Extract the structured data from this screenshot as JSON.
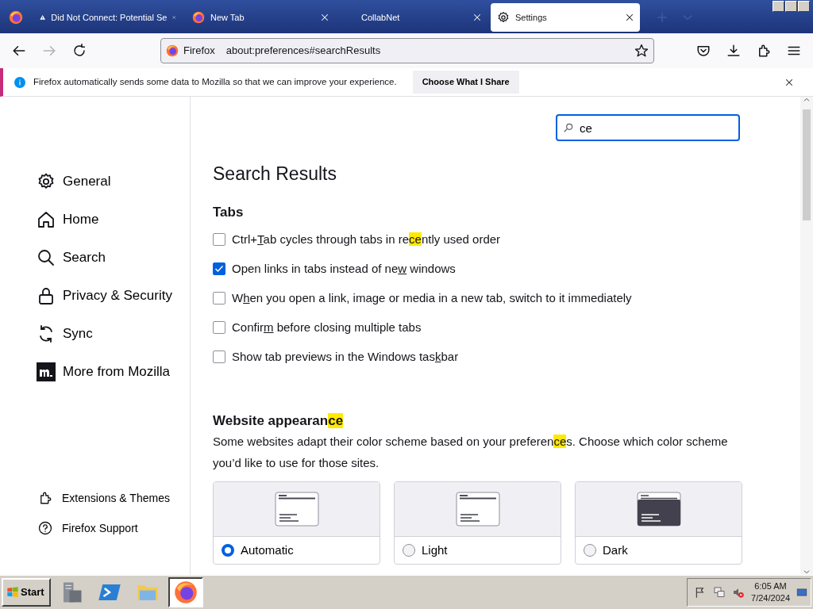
{
  "browser": {
    "tabs": [
      {
        "kind": "view",
        "selected": false
      },
      {
        "kind": "warning",
        "label": "Did Not Connect: Potential Se",
        "selected": false
      },
      {
        "kind": "firefox",
        "label": "New Tab",
        "selected": false
      },
      {
        "kind": "plain",
        "label": "CollabNet",
        "selected": false
      },
      {
        "kind": "gear",
        "label": "Settings",
        "selected": true
      }
    ],
    "url": {
      "identity": "Firefox",
      "address": "about:preferences#searchResults"
    },
    "notification": {
      "message": "Firefox automatically sends some data to Mozilla so that we can improve your experience.",
      "button": "Choose What I Share"
    }
  },
  "sidebar": {
    "categories": [
      {
        "label": "General",
        "selected": false
      },
      {
        "label": "Home",
        "selected": false
      },
      {
        "label": "Search",
        "selected": false
      },
      {
        "label": "Privacy & Security",
        "selected": false
      },
      {
        "label": "Sync",
        "selected": false
      },
      {
        "label": "More from Mozilla",
        "selected": false
      }
    ],
    "footer": [
      {
        "label": "Extensions & Themes"
      },
      {
        "label": "Firefox Support"
      }
    ]
  },
  "search": {
    "value": "ce"
  },
  "results": {
    "title": "Search Results",
    "sections": [
      {
        "kind": "checkboxes",
        "heading": [
          {
            "kind": "plain",
            "text": "Tabs"
          }
        ],
        "options": [
          {
            "checked": false,
            "label": [
              {
                "kind": "plain",
                "text": "Ctrl+"
              },
              {
                "kind": "access",
                "text": "T"
              },
              {
                "kind": "plain",
                "text": "ab cycles through tabs in re"
              },
              {
                "kind": "match",
                "text": "ce"
              },
              {
                "kind": "plain",
                "text": "ntly used order"
              }
            ]
          },
          {
            "checked": true,
            "label": [
              {
                "kind": "plain",
                "text": "Open links in tabs instead of ne"
              },
              {
                "kind": "access",
                "text": "w"
              },
              {
                "kind": "plain",
                "text": " windows"
              }
            ]
          },
          {
            "checked": false,
            "label": [
              {
                "kind": "plain",
                "text": "W"
              },
              {
                "kind": "access",
                "text": "h"
              },
              {
                "kind": "plain",
                "text": "en you open a link, image or media in a new tab, switch to it immediately"
              }
            ]
          },
          {
            "checked": false,
            "label": [
              {
                "kind": "plain",
                "text": "Confir"
              },
              {
                "kind": "access",
                "text": "m"
              },
              {
                "kind": "plain",
                "text": " before closing multiple tabs"
              }
            ]
          },
          {
            "checked": false,
            "label": [
              {
                "kind": "plain",
                "text": "Show tab previews in the Windows tas"
              },
              {
                "kind": "access",
                "text": "k"
              },
              {
                "kind": "plain",
                "text": "bar"
              }
            ]
          }
        ]
      },
      {
        "kind": "schemes",
        "heading": [
          {
            "kind": "plain",
            "text": "Website appearan"
          },
          {
            "kind": "match",
            "text": "ce"
          }
        ],
        "description": [
          {
            "kind": "plain",
            "text": "Some websites adapt their color scheme based on your preferen"
          },
          {
            "kind": "match",
            "text": "ce"
          },
          {
            "kind": "plain",
            "text": "s. Choose which color scheme you’d like to use for those sites."
          }
        ],
        "options": [
          {
            "kind": "light",
            "label": "Automatic",
            "selected": true
          },
          {
            "kind": "light",
            "label": "Light",
            "selected": false
          },
          {
            "kind": "dark",
            "label": "Dark",
            "selected": false
          }
        ]
      }
    ]
  },
  "taskbar": {
    "start": "Start",
    "apps": [
      {
        "kind": "server",
        "selected": false
      },
      {
        "kind": "powershell",
        "selected": false
      },
      {
        "kind": "explorer",
        "selected": false
      },
      {
        "kind": "firefox",
        "selected": true
      }
    ],
    "time": "6:05 AM",
    "date": "7/24/2024"
  }
}
